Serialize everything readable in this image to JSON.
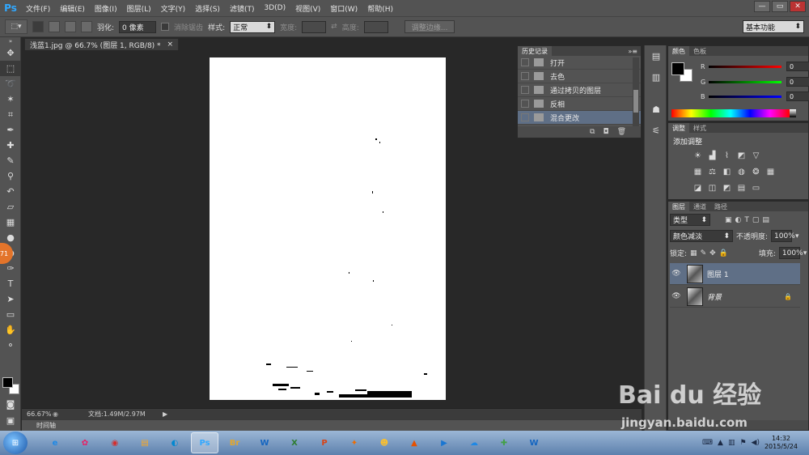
{
  "app": {
    "logo": "Ps"
  },
  "menu": [
    "文件(F)",
    "编辑(E)",
    "图像(I)",
    "图层(L)",
    "文字(Y)",
    "选择(S)",
    "滤镜(T)",
    "3D(D)",
    "视图(V)",
    "窗口(W)",
    "帮助(H)"
  ],
  "window_controls": [
    "—",
    "▭",
    "✕"
  ],
  "options_bar": {
    "feather_label": "羽化:",
    "feather_value": "0 像素",
    "antialias_label": "消除锯齿",
    "style_label": "样式:",
    "style_value": "正常",
    "width_label": "宽度:",
    "height_label": "高度:",
    "refine_edge": "调整边缘...",
    "workspace": "基本功能"
  },
  "document": {
    "tab_title": "浅蓝1.jpg @ 66.7% (图层 1, RGB/8) *",
    "zoom": "66.67%",
    "doc_size": "文档:1.49M/2.97M"
  },
  "timeline_label": "时间轴",
  "badge_value": "71",
  "history": {
    "tabs": [
      "历史记录"
    ],
    "items": [
      {
        "label": "打开",
        "selected": false
      },
      {
        "label": "去色",
        "selected": false
      },
      {
        "label": "通过拷贝的图层",
        "selected": false
      },
      {
        "label": "反相",
        "selected": false
      },
      {
        "label": "混合更改",
        "selected": true
      }
    ]
  },
  "color_panel": {
    "tabs": [
      "颜色",
      "色板"
    ],
    "channels": [
      {
        "letter": "R",
        "value": "0"
      },
      {
        "letter": "G",
        "value": "0"
      },
      {
        "letter": "B",
        "value": "0"
      }
    ]
  },
  "adjust_panel": {
    "tabs": [
      "调整",
      "样式"
    ],
    "title": "添加调整"
  },
  "layers_panel": {
    "tabs": [
      "图层",
      "通道",
      "路径"
    ],
    "filter_label": "类型",
    "blend_mode": "颜色减淡",
    "opacity_label": "不透明度:",
    "opacity_value": "100%",
    "lock_label": "锁定:",
    "fill_label": "填充:",
    "fill_value": "100%",
    "layers": [
      {
        "name": "图层 1",
        "selected": true,
        "locked": false
      },
      {
        "name": "背景",
        "selected": false,
        "locked": true
      }
    ]
  },
  "taskbar": {
    "apps": [
      {
        "name": "ie",
        "glyph": "e",
        "color": "#1e88e5"
      },
      {
        "name": "picasa",
        "glyph": "✿",
        "color": "#e91e63"
      },
      {
        "name": "chrome",
        "glyph": "◉",
        "color": "#d32f2f"
      },
      {
        "name": "explorer",
        "glyph": "▤",
        "color": "#f9a825"
      },
      {
        "name": "qq-player",
        "glyph": "◐",
        "color": "#0288d1"
      },
      {
        "name": "photoshop",
        "glyph": "Ps",
        "color": "#31a8ff"
      },
      {
        "name": "bridge",
        "glyph": "Br",
        "color": "#e2a72e"
      },
      {
        "name": "word",
        "glyph": "W",
        "color": "#1565c0"
      },
      {
        "name": "excel",
        "glyph": "X",
        "color": "#2e7d32"
      },
      {
        "name": "powerpoint",
        "glyph": "P",
        "color": "#d84315"
      },
      {
        "name": "wps",
        "glyph": "✦",
        "color": "#ef6c00"
      },
      {
        "name": "paint",
        "glyph": "☻",
        "color": "#fbc02d"
      },
      {
        "name": "matlab",
        "glyph": "▲",
        "color": "#e65100"
      },
      {
        "name": "video-player",
        "glyph": "▶",
        "color": "#1976d2"
      },
      {
        "name": "baidu-cloud",
        "glyph": "☁",
        "color": "#1e88e5"
      },
      {
        "name": "360-security",
        "glyph": "✚",
        "color": "#43a047"
      },
      {
        "name": "wps-writer",
        "glyph": "W",
        "color": "#1565c0"
      }
    ],
    "time": "14:32",
    "date": "2015/5/24"
  },
  "watermark": {
    "brand": "Bai du 经验",
    "url": "jingyan.baidu.com"
  }
}
